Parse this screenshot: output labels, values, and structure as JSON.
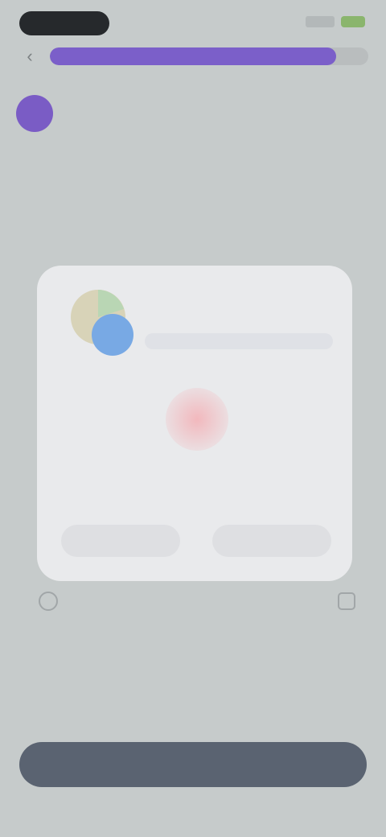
{
  "status_bar": {
    "time": "",
    "signal_icon": "signal-icon",
    "battery_icon": "battery-icon"
  },
  "header": {
    "back_icon": "back-arrow-icon",
    "progress_fraction": 0.9,
    "avatar_icon": "avatar",
    "label": "",
    "question": ""
  },
  "dialog": {
    "logo_icon": "browser-logo-icon",
    "url_text": "",
    "title": "",
    "body": "",
    "left_button": "",
    "right_button": ""
  },
  "footer": {
    "left_icon": "checkbox-icon",
    "text": "",
    "right_icon": "info-icon"
  },
  "primary_button": {
    "label": ""
  },
  "colors": {
    "background": "#c6cbcb",
    "accent": "#7b5fc9",
    "card": "#e9eaec",
    "primary_button": "#5a6371"
  }
}
